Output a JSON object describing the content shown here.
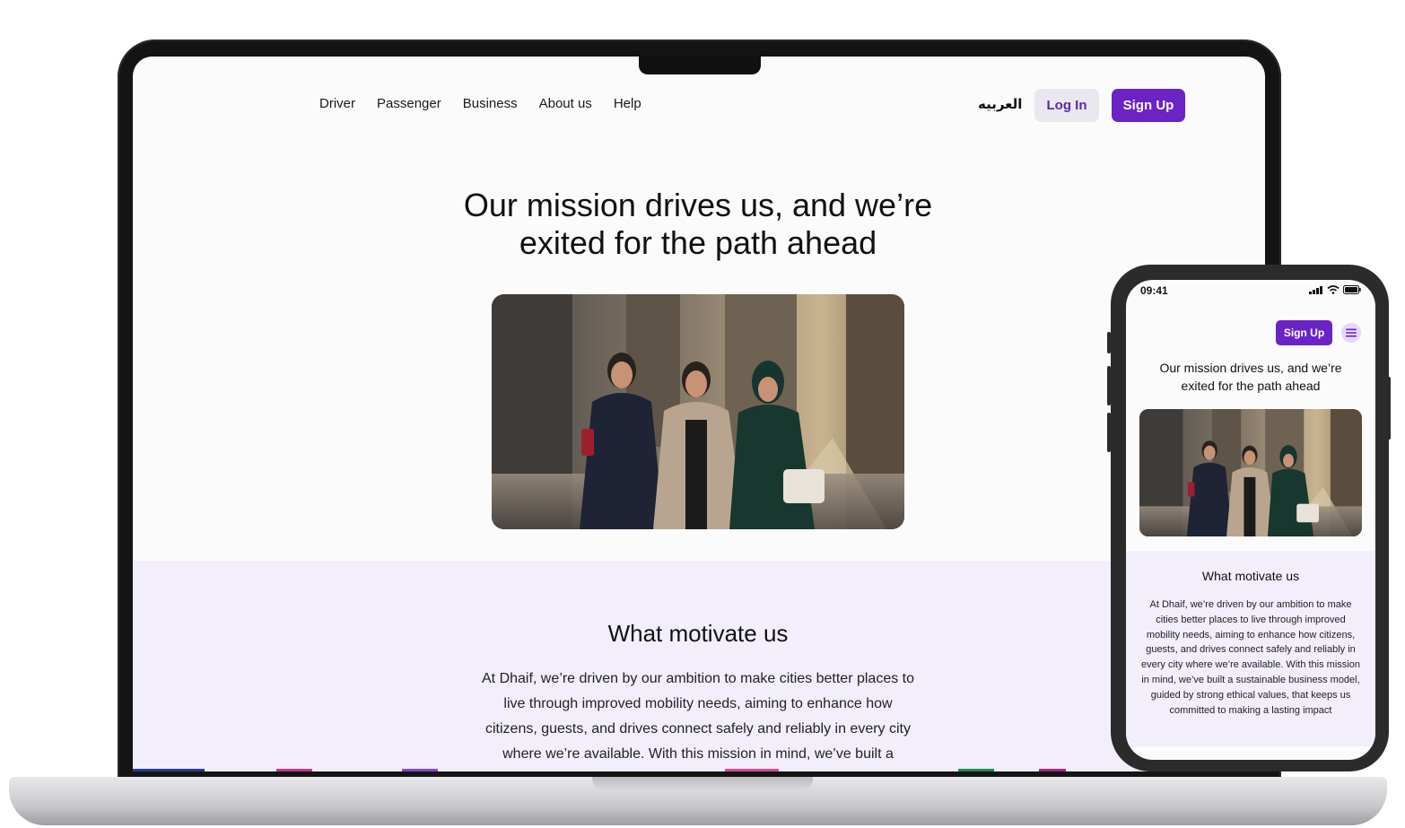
{
  "desktop": {
    "nav": {
      "items": [
        "Driver",
        "Passenger",
        "Business",
        "About us",
        "Help"
      ],
      "language": "العربيه",
      "login_label": "Log In",
      "signup_label": "Sign Up"
    },
    "hero": {
      "title_line1": "Our mission drives us, and we’re",
      "title_line2": "exited for the path ahead"
    },
    "motivate": {
      "heading": "What motivate us",
      "body": "At Dhaif, we’re driven by our ambition to make cities better places to live through improved mobility needs, aiming to enhance how citizens, guests, and drives connect safely and reliably in every city where we’re available. With this mission in mind, we’ve built a"
    }
  },
  "mobile": {
    "status": {
      "time": "09:41"
    },
    "signup_label": "Sign Up",
    "hero": {
      "title_line1": "Our mission drives us, and we’re",
      "title_line2": "exited for the path ahead"
    },
    "motivate": {
      "heading": "What motivate us",
      "body": "At Dhaif, we’re driven by our ambition to make cities better places to live through improved mobility needs, aiming to enhance how citizens, guests, and drives connect safely and reliably in every city where we’re available. With this mission in mind, we’ve built a sustainable business model, guided by strong ethical values, that keeps us committed to making a lasting impact"
    }
  },
  "theme": {
    "accent": "#6b23c5",
    "accent_soft": "#f3eefc",
    "login_bg": "#ebe7f0"
  },
  "icons": [
    "menu-icon",
    "signal-icon",
    "wifi-icon",
    "battery-icon"
  ]
}
